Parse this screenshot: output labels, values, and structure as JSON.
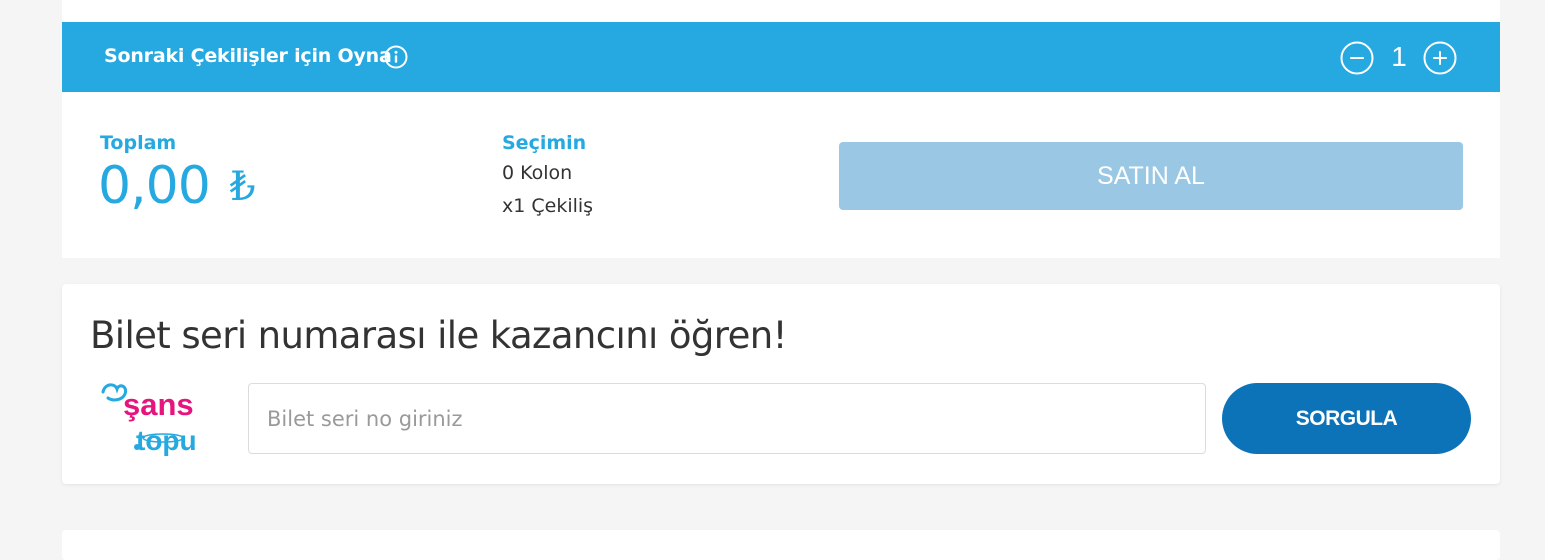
{
  "draw_bar": {
    "title": "Sonraki Çekilişler için Oyna",
    "info_icon": "info-circle-icon",
    "minus_icon": "minus-circle-icon",
    "plus_icon": "plus-circle-icon",
    "draw_count": "1",
    "background_color": "#25a9e0"
  },
  "summary": {
    "total_label": "Toplam",
    "total_amount": "0,00",
    "currency_symbol": "₺",
    "selection_label": "Seçimin",
    "columns_text": "0 Kolon",
    "draws_text": "x1 Çekiliş",
    "buy_button_label": "SATIN AL",
    "buy_button_color": "#9ac8e4"
  },
  "ticket_query": {
    "title": "Bilet seri numarası ile kazancını öğren!",
    "logo": {
      "line1": "şans",
      "line2": "topu",
      "icon": "sans-topu-logo"
    },
    "serial_placeholder": "Bilet seri no giriniz",
    "serial_value": "",
    "query_button_label": "SORGULA",
    "query_button_color": "#0c73b9"
  },
  "colors": {
    "accent": "#25a9e0",
    "page_background": "#f5f5f5",
    "logo_pink": "#e6157e",
    "logo_blue": "#25a9e0"
  }
}
